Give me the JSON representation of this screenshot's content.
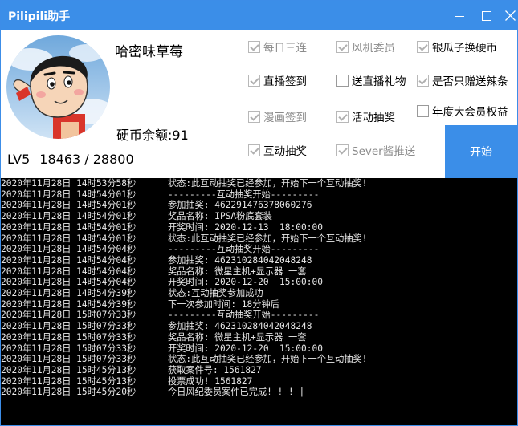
{
  "app": {
    "title": "Pilipili助手"
  },
  "user": {
    "name": "哈密味草莓",
    "coins_label": "硬币余额:91",
    "level": "LV5",
    "exp": "18463 / 28800"
  },
  "options": [
    {
      "label": "每日三连",
      "checked": true,
      "disabled": true
    },
    {
      "label": "风机委员",
      "checked": true,
      "disabled": true
    },
    {
      "label": "银瓜子换硬币",
      "checked": true,
      "disabled": false
    },
    {
      "label": "直播签到",
      "checked": true,
      "disabled": false
    },
    {
      "label": "送直播礼物",
      "checked": false,
      "disabled": false
    },
    {
      "label": "是否只赠送辣条",
      "checked": true,
      "disabled": false
    },
    {
      "label": "漫画签到",
      "checked": true,
      "disabled": true
    },
    {
      "label": "活动抽奖",
      "checked": true,
      "disabled": false
    },
    {
      "label": "年度大会员权益",
      "checked": false,
      "disabled": false
    },
    {
      "label": "互动抽奖",
      "checked": true,
      "disabled": false
    },
    {
      "label": "Sever酱推送",
      "checked": true,
      "disabled": true
    }
  ],
  "start_button": "开始",
  "log": [
    {
      "ts": "2020年11月28日 14时53分58秒",
      "msg": "状态:此互动抽奖已经参加，开始下一个互动抽奖!"
    },
    {
      "ts": "2020年11月28日 14时54分01秒",
      "msg": "---------互动抽奖开始---------"
    },
    {
      "ts": "2020年11月28日 14时54分01秒",
      "msg": "参加抽奖: 462291476378060276"
    },
    {
      "ts": "2020年11月28日 14时54分01秒",
      "msg": "奖品名称: IPSA粉底套装"
    },
    {
      "ts": "2020年11月28日 14时54分01秒",
      "msg": "开奖时间: 2020-12-13  18:00:00"
    },
    {
      "ts": "2020年11月28日 14时54分01秒",
      "msg": "状态:此互动抽奖已经参加，开始下一个互动抽奖!"
    },
    {
      "ts": "2020年11月28日 14时54分04秒",
      "msg": "---------互动抽奖开始---------"
    },
    {
      "ts": "2020年11月28日 14时54分04秒",
      "msg": "参加抽奖: 462310284042048248"
    },
    {
      "ts": "2020年11月28日 14时54分04秒",
      "msg": "奖品名称: 微星主机+显示器 一套"
    },
    {
      "ts": "2020年11月28日 14时54分04秒",
      "msg": "开奖时间: 2020-12-20  15:00:00"
    },
    {
      "ts": "2020年11月28日 14时54分39秒",
      "msg": "状态:互动抽奖参加成功"
    },
    {
      "ts": "2020年11月28日 14时54分39秒",
      "msg": "下一次参加时间: 18分钟后"
    },
    {
      "ts": "2020年11月28日 15时07分33秒",
      "msg": "---------互动抽奖开始---------"
    },
    {
      "ts": "2020年11月28日 15时07分33秒",
      "msg": "参加抽奖: 462310284042048248"
    },
    {
      "ts": "2020年11月28日 15时07分33秒",
      "msg": "奖品名称: 微星主机+显示器 一套"
    },
    {
      "ts": "2020年11月28日 15时07分33秒",
      "msg": "开奖时间: 2020-12-20  15:00:00"
    },
    {
      "ts": "2020年11月28日 15时07分33秒",
      "msg": "状态:此互动抽奖已经参加，开始下一个互动抽奖!"
    },
    {
      "ts": "2020年11月28日 15时45分13秒",
      "msg": "获取案件号: 1561827"
    },
    {
      "ts": "2020年11月28日 15时45分13秒",
      "msg": "投票成功! 1561827"
    },
    {
      "ts": "2020年11月28日 15时45分20秒",
      "msg": "今日风纪委员案件已完成! ! ! |"
    }
  ]
}
